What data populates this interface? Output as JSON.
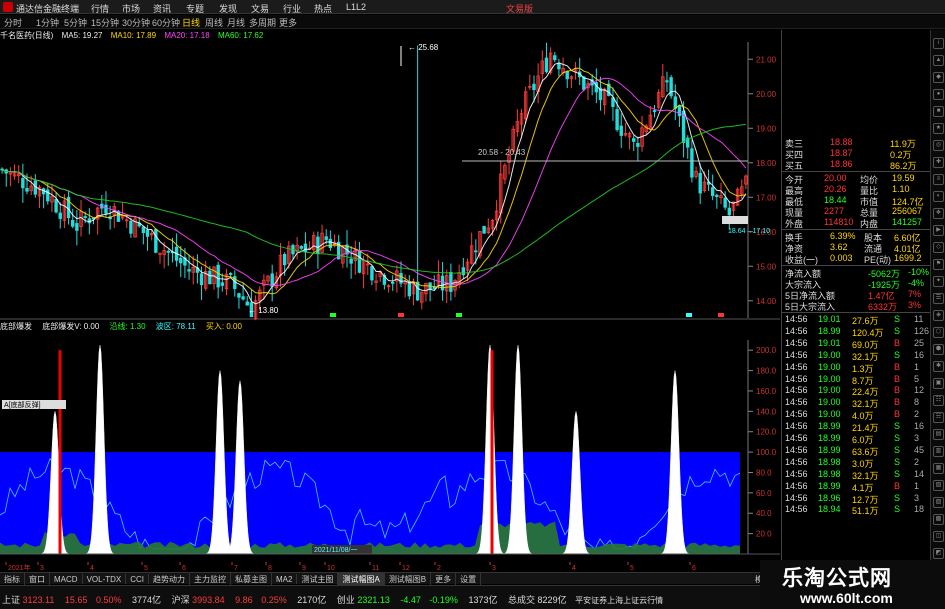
{
  "titlebar": {
    "app_name": "通达信金融终端",
    "menus": [
      "行情",
      "市场",
      "资讯",
      "专题",
      "发现",
      "文易",
      "行业",
      "热点",
      "L1L2"
    ],
    "account": "文易版"
  },
  "periods": [
    "分时",
    "1分钟",
    "5分钟",
    "15分钟",
    "30分钟",
    "60分钟",
    "日线",
    "周线",
    "月线",
    "多周期",
    "更多"
  ],
  "active_period": "日线",
  "main_info": {
    "stock": "千名医药(日线)",
    "ma5": "MA5: 19.27",
    "ma10": "MA10: 17.89",
    "ma20": "MA20: 17.18",
    "ma60": "MA60: 17.62"
  },
  "main_chart": {
    "y_ticks": [
      "21.00",
      "20.00",
      "19.00",
      "18.00",
      "17.00",
      "16.00",
      "15.00",
      "14.00"
    ],
    "high_label": "25.68",
    "low_label": "13.80",
    "range_label": "20.58 - 20.43",
    "price_tag": "18.64→17.10"
  },
  "sub_info": {
    "name": "底部爆发",
    "value": "底部爆发V: 0.00",
    "item1": "沿线: 1.30",
    "item2": "波区: 78.11",
    "item3": "买入: 0.00"
  },
  "sub_chart": {
    "y_ticks": [
      "200.0",
      "180.0",
      "160.0",
      "140.0",
      "120.0",
      "100.0",
      "80.0",
      "60.0",
      "40.0",
      "20.0"
    ],
    "marker_label": "A[底部反弹]",
    "date_tag": "2021/11/08/一"
  },
  "date_axis": [
    "2021年",
    "3",
    "4",
    "5",
    "6",
    "7",
    "8",
    "9",
    "10",
    "11",
    "12",
    "2",
    "3",
    "4",
    "5",
    "6"
  ],
  "tabs": [
    "指标",
    "窗口",
    "MACD",
    "VOL-TDX",
    "CCI",
    "趋势动力",
    "主力监控",
    "私募主图",
    "MA2",
    "测试主图",
    "测试幅图A",
    "测试幅图B",
    "更多",
    "设置"
  ],
  "tab_end": "模板",
  "quote_top": [
    {
      "label": "卖三",
      "price": "18.88",
      "vol": "11.9万"
    },
    {
      "label": "买四",
      "price": "18.87",
      "vol": "0.2万"
    },
    {
      "label": "买五",
      "price": "18.86",
      "vol": "86.2万"
    }
  ],
  "quote_stats": [
    {
      "l1": "今开",
      "v1": "20.00",
      "l2": "均价",
      "v2": "19.59"
    },
    {
      "l1": "最高",
      "v1": "20.26",
      "l2": "量比",
      "v2": "1.10"
    },
    {
      "l1": "最低",
      "v1": "18.44",
      "l2": "市值",
      "v2": "124.7亿"
    },
    {
      "l1": "现量",
      "v1": "2277",
      "l2": "总量",
      "v2": "256067"
    },
    {
      "l1": "外盘",
      "v1": "114810",
      "l2": "内盘",
      "v2": "141257"
    }
  ],
  "quote_stats2": [
    {
      "l1": "换手",
      "v1": "6.39%",
      "l2": "股本",
      "v2": "6.60亿"
    },
    {
      "l1": "净资",
      "v1": "3.62",
      "l2": "流通",
      "v2": "4.01亿"
    },
    {
      "l1": "收益(一)",
      "v1": "0.003",
      "l2": "PE(动)",
      "v2": "1699.2"
    }
  ],
  "flows": [
    {
      "label": "净流入额",
      "value": "-5062万",
      "pct": "-10%"
    },
    {
      "label": "大宗流入",
      "value": "-1925万",
      "pct": "-4%"
    },
    {
      "label": "5日净流入额",
      "value": "1.47亿",
      "pct": "7%"
    },
    {
      "label": "5日大宗流入",
      "value": "6332万",
      "pct": "3%"
    }
  ],
  "ticks": [
    {
      "time": "14:56",
      "price": "19.01",
      "vol": "27.6万",
      "side": "S",
      "n": "11"
    },
    {
      "time": "14:56",
      "price": "18.99",
      "vol": "120.4万",
      "side": "S",
      "n": "126"
    },
    {
      "time": "14:56",
      "price": "19.01",
      "vol": "69.0万",
      "side": "B",
      "n": "25"
    },
    {
      "time": "14:56",
      "price": "19.00",
      "vol": "32.1万",
      "side": "S",
      "n": "16"
    },
    {
      "time": "14:56",
      "price": "19.00",
      "vol": "1.3万",
      "side": "B",
      "n": "1"
    },
    {
      "time": "14:56",
      "price": "19.00",
      "vol": "8.7万",
      "side": "B",
      "n": "5"
    },
    {
      "time": "14:56",
      "price": "19.00",
      "vol": "22.4万",
      "side": "B",
      "n": "12"
    },
    {
      "time": "14:56",
      "price": "19.00",
      "vol": "32.1万",
      "side": "B",
      "n": "8"
    },
    {
      "time": "14:56",
      "price": "19.00",
      "vol": "4.0万",
      "side": "B",
      "n": "2"
    },
    {
      "time": "14:56",
      "price": "18.99",
      "vol": "21.4万",
      "side": "S",
      "n": "16"
    },
    {
      "time": "14:56",
      "price": "18.99",
      "vol": "6.0万",
      "side": "S",
      "n": "3"
    },
    {
      "time": "14:56",
      "price": "18.99",
      "vol": "63.6万",
      "side": "S",
      "n": "45"
    },
    {
      "time": "14:56",
      "price": "18.98",
      "vol": "3.0万",
      "side": "S",
      "n": "2"
    },
    {
      "time": "14:56",
      "price": "18.98",
      "vol": "32.1万",
      "side": "S",
      "n": "14"
    },
    {
      "time": "14:56",
      "price": "18.99",
      "vol": "4.1万",
      "side": "B",
      "n": "1"
    },
    {
      "time": "14:56",
      "price": "18.96",
      "vol": "12.7万",
      "side": "S",
      "n": "3"
    },
    {
      "time": "14:56",
      "price": "18.94",
      "vol": "51.1万",
      "side": "S",
      "n": "18"
    }
  ],
  "statusbar": {
    "sh_label": "上证",
    "sh_val": "3123.11",
    "sh_chg": "15.65",
    "sh_pct": "0.50%",
    "sh_amt": "3774亿",
    "sz_label": "沪深",
    "sz_val": "3993.84",
    "sz_chg": "9.86",
    "sz_pct": "0.25%",
    "sz_amt": "2170亿",
    "cy_label": "创业",
    "cy_val": "2321.13",
    "cy_chg": "-4.47",
    "cy_pct": "-0.19%",
    "cy_amt": "1373亿",
    "total_label": "总成交",
    "total_amt": "8229亿",
    "broker": "平安证券上海上证云行情"
  },
  "watermark": {
    "cn": "乐淘公式网",
    "url": "www.60lt.com"
  },
  "colors": {
    "up": "#ff3b3b",
    "down": "#22ff22",
    "ma5": "#ffffff",
    "ma10": "#ffd700",
    "ma20": "#ff44ff",
    "ma60": "#22cc22",
    "blue_band": "#0000ff"
  }
}
